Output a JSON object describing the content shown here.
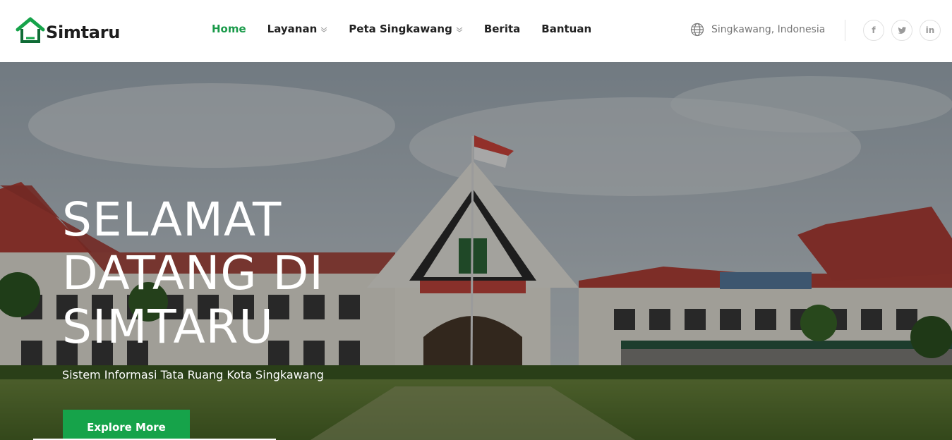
{
  "brand": {
    "name": "Simtaru",
    "accent": "#16a34a"
  },
  "nav": {
    "items": [
      {
        "label": "Home",
        "active": true,
        "dropdown": false
      },
      {
        "label": "Layanan",
        "active": false,
        "dropdown": true
      },
      {
        "label": "Peta Singkawang",
        "active": false,
        "dropdown": true
      },
      {
        "label": "Berita",
        "active": false,
        "dropdown": false
      },
      {
        "label": "Bantuan",
        "active": false,
        "dropdown": false
      }
    ]
  },
  "location": {
    "label": "Singkawang, Indonesia",
    "icon": "globe-icon"
  },
  "social": [
    {
      "label": "f",
      "icon": "facebook-icon"
    },
    {
      "label": "t",
      "icon": "twitter-icon"
    },
    {
      "label": "in",
      "icon": "linkedin-icon"
    }
  ],
  "hero": {
    "title_line1": "SELAMAT",
    "title_line2": "DATANG DI",
    "title_line3": "SIMTARU",
    "subtitle": "Sistem Informasi Tata Ruang Kota Singkawang",
    "cta_label": "Explore More"
  }
}
